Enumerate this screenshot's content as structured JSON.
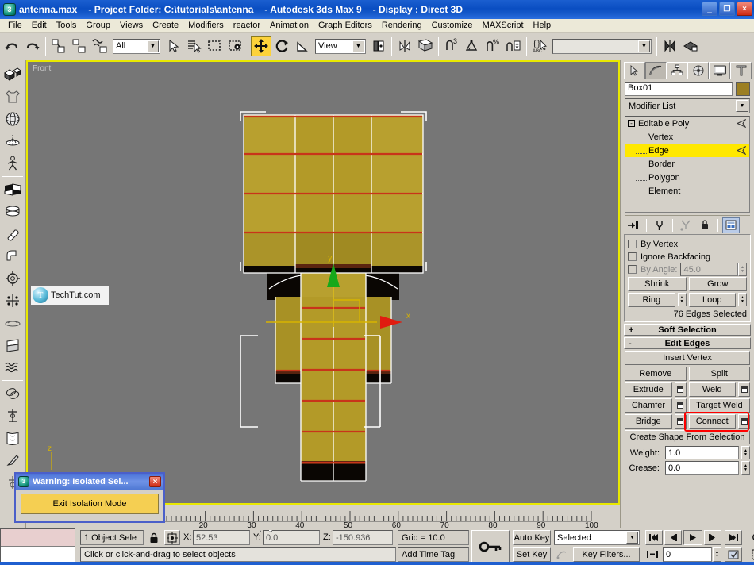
{
  "titlebar": {
    "file": "antenna.max",
    "project": "- Project Folder: C:\\tutorials\\antenna",
    "app": "- Autodesk 3ds Max 9",
    "display": "- Display : Direct 3D",
    "minimize": "_",
    "restore": "❐",
    "close": "×",
    "app_icon": "3"
  },
  "menu": {
    "items": [
      "File",
      "Edit",
      "Tools",
      "Group",
      "Views",
      "Create",
      "Modifiers",
      "reactor",
      "Animation",
      "Graph Editors",
      "Rendering",
      "Customize",
      "MAXScript",
      "Help"
    ]
  },
  "toolbar": {
    "selection_filter": "All",
    "coord_system": "View",
    "named_selection_set": "",
    "icons": [
      "undo-icon",
      "redo-icon",
      "select-and-link-icon",
      "unlink-selection-icon",
      "bind-to-space-warp-icon",
      "select-object-icon",
      "select-by-name-icon",
      "rectangular-selection-region-icon",
      "window-crossing-icon",
      "select-and-move-icon",
      "select-and-rotate-icon",
      "select-and-scale-icon",
      "use-pivot-point-center-icon",
      "mirror-icon",
      "align-icon",
      "snap-toggle-icon",
      "angle-snap-toggle-icon",
      "percent-snap-toggle-icon",
      "spinner-snap-toggle-icon",
      "named-selection-sets-icon",
      "mirror-flip-icon",
      "layer-manager-icon"
    ],
    "active_tool": "select-and-move-icon"
  },
  "left_toolbar": {
    "icons": [
      "box-object-icon",
      "garment-maker-icon",
      "sphere-object-icon",
      "lathe-icon",
      "biped-icon",
      "edit-mesh-icon",
      "loft-icon",
      "capsule-icon",
      "bend-icon",
      "gear-icon",
      "cross-section-icon",
      "flatten-icon",
      "twist-icon",
      "ripple-icon",
      "torus-knot-icon",
      "skeleton-icon",
      "skin-icon",
      "paint-deform-icon",
      "helper-icon"
    ]
  },
  "viewport": {
    "label": "Front",
    "watermark": "TechTut.com",
    "watermark_logo": "T",
    "axis_x_label": "x",
    "axis_y_label": "y",
    "axis_z_label": "z",
    "mesh_face_color": "#b39a28",
    "selected_edge_color": "#c8341a",
    "wire_color": "#ffffff"
  },
  "timeline": {
    "labels": [
      "20",
      "30",
      "40",
      "50",
      "60",
      "70",
      "80",
      "90",
      "100"
    ],
    "start": 0,
    "end": 100
  },
  "command_panel": {
    "tabs": [
      {
        "name": "create-tab",
        "icon": "arrow-icon",
        "selected": false
      },
      {
        "name": "modify-tab",
        "icon": "curve-icon",
        "selected": true
      },
      {
        "name": "hierarchy-tab",
        "icon": "hierarchy-icon",
        "selected": false
      },
      {
        "name": "motion-tab",
        "icon": "wheel-icon",
        "selected": false
      },
      {
        "name": "display-tab",
        "icon": "monitor-icon",
        "selected": false
      },
      {
        "name": "utilities-tab",
        "icon": "hammer-icon",
        "selected": false
      }
    ],
    "object_name": "Box01",
    "object_color": "#9c7f22",
    "modifier_list_label": "Modifier List",
    "stack": [
      {
        "label": "Editable Poly",
        "level": 0,
        "selected": false,
        "expander": "-"
      },
      {
        "label": "Vertex",
        "level": 1,
        "selected": false
      },
      {
        "label": "Edge",
        "level": 1,
        "selected": true
      },
      {
        "label": "Border",
        "level": 1,
        "selected": false
      },
      {
        "label": "Polygon",
        "level": 1,
        "selected": false
      },
      {
        "label": "Element",
        "level": 1,
        "selected": false
      }
    ],
    "stack_buttons": [
      "pin-stack-icon",
      "show-end-result-icon",
      "make-unique-icon",
      "remove-modifier-icon",
      "configure-modifier-sets-icon"
    ],
    "selection": {
      "by_vertex_label": "By Vertex",
      "by_vertex_checked": false,
      "ignore_backfacing_label": "Ignore Backfacing",
      "ignore_backfacing_checked": false,
      "by_angle_label": "By Angle:",
      "by_angle_value": "45.0",
      "by_angle_checked": false,
      "shrink_label": "Shrink",
      "grow_label": "Grow",
      "ring_label": "Ring",
      "loop_label": "Loop",
      "status": "76 Edges Selected"
    },
    "soft_selection_label": "Soft Selection",
    "soft_selection_sign": "+",
    "edit_edges_label": "Edit Edges",
    "edit_edges_sign": "-",
    "edit_edges": {
      "insert_vertex": "Insert Vertex",
      "remove": "Remove",
      "split": "Split",
      "extrude": "Extrude",
      "weld": "Weld",
      "chamfer": "Chamfer",
      "target_weld": "Target Weld",
      "bridge": "Bridge",
      "connect": "Connect",
      "create_shape": "Create Shape From Selection",
      "weight_label": "Weight:",
      "weight_value": "1.0",
      "crease_label": "Crease:",
      "crease_value": "0.0"
    },
    "highlight_color": "#ff0000",
    "highlighted_button": "Connect"
  },
  "warning_dialog": {
    "title": "Warning: Isolated Sel...",
    "icon": "max-icon",
    "close": "×",
    "button": "Exit Isolation Mode"
  },
  "status_bar": {
    "object_count": "1 Object Sele",
    "lock_icon": "lock-icon",
    "transform_icon": "absolute-mode-icon",
    "x_label": "X:",
    "x_value": "52.53",
    "y_label": "Y:",
    "y_value": "0.0",
    "z_label": "Z:",
    "z_value": "-150.936",
    "grid": "Grid = 10.0",
    "prompt": "Click or click-and-drag to select objects",
    "add_time_tag": "Add Time Tag",
    "auto_key": "Auto Key",
    "set_key": "Set Key",
    "key_mode": "Selected",
    "key_filters": "Key Filters...",
    "frame_value": "0",
    "playback_icons": [
      "go-to-start-icon",
      "previous-frame-icon",
      "play-icon",
      "next-frame-icon",
      "go-to-end-icon"
    ],
    "nav_icons": [
      "zoom-icon",
      "zoom-all-icon",
      "zoom-extents-icon",
      "zoom-extents-all-icon",
      "field-of-view-icon",
      "region-zoom-icon",
      "pan-icon",
      "arc-rotate-icon",
      "maximize-viewport-icon"
    ]
  }
}
